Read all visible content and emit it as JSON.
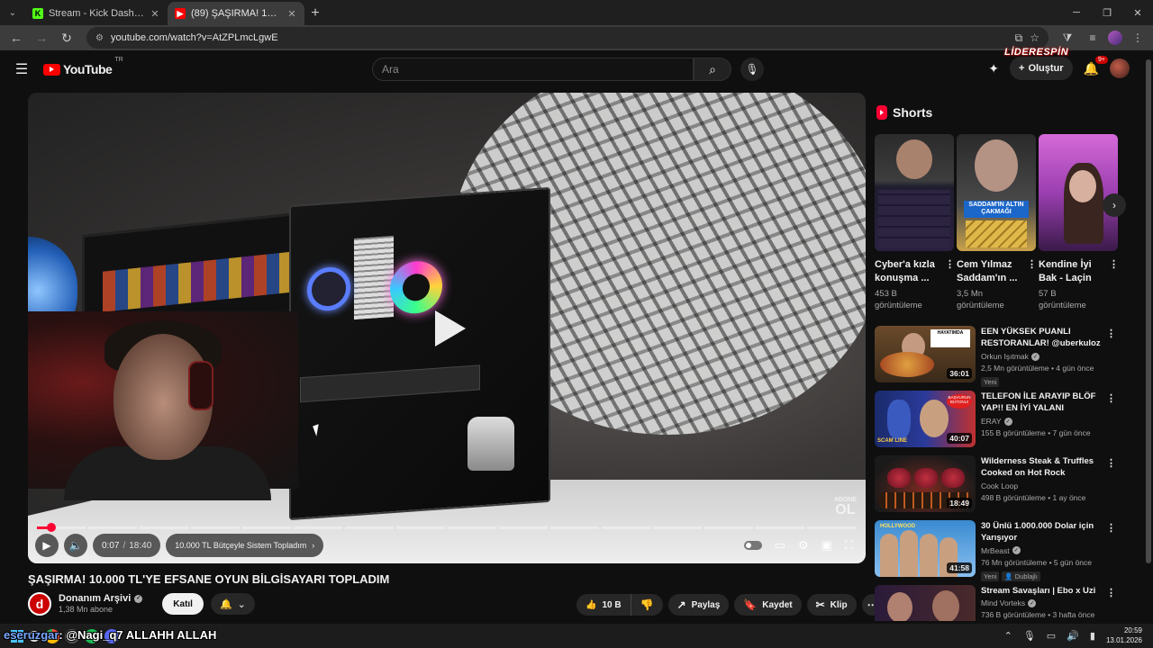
{
  "browser": {
    "tabs": [
      {
        "title": "Stream - Kick Dashboard",
        "favicon": "kick-icon",
        "active": false
      },
      {
        "title": "(89) ŞAŞIRMA! 10.000 TL'YE EFSANE",
        "favicon": "youtube-icon",
        "active": true
      }
    ],
    "url": "youtube.com/watch?v=AtZPLmcLgwE"
  },
  "header": {
    "logo_text": "YouTube",
    "logo_region": "TR",
    "search_placeholder": "Ara",
    "create_label": "Oluştur",
    "notification_count": "9+",
    "overlay_brand": "LİDERESPİN"
  },
  "player": {
    "time_current": "0:07",
    "time_separator": "/",
    "time_total": "18:40",
    "chapter": "10.000 TL Bütçeyle Sistem Topladım",
    "progress": 0.006,
    "watermark_top": "ABONE",
    "watermark_bottom": "OL"
  },
  "video": {
    "title": "ŞAŞIRMA! 10.000 TL'YE EFSANE OYUN BİLGİSAYARI TOPLADIM",
    "channel_name": "Donanım Arşivi",
    "subscribers": "1,38 Mn abone",
    "join_label": "Katıl",
    "like_count": "10 B",
    "share_label": "Paylaş",
    "save_label": "Kaydet",
    "clip_label": "Klip"
  },
  "shorts": {
    "heading": "Shorts",
    "items": [
      {
        "title": "Cyber'a kızla konuşma ...",
        "views_line1": "453 B",
        "views_line2": "görüntüleme"
      },
      {
        "title": "Cem Yılmaz Saddam'ın ...",
        "views_line1": "3,5 Mn",
        "views_line2": "görüntüleme",
        "thumb_caption": "SADDAM'IN ALTIN ÇAKMAĞI"
      },
      {
        "title": "Kendine İyi Bak - Laçin",
        "views_line1": "57 B",
        "views_line2": "görüntüleme"
      }
    ]
  },
  "recommendations": [
    {
      "title": "EEN YÜKSEK PUANLI RESTORANLAR! @uberkuloz ...",
      "channel": "Orkun Işıtmak",
      "verified": true,
      "meta": "2,5 Mn görüntüleme • 4 gün önce",
      "tags": [
        "Yeni"
      ],
      "duration": "36:01",
      "thumb_text": "HAYATIMDA"
    },
    {
      "title": "TELEFON İLE ARAYIP BLÖF YAP!! EN İYİ YALANI SÖYLEYE...",
      "channel": "ERAY",
      "verified": true,
      "meta": "155 B görüntüleme • 7 gün önce",
      "tags": [],
      "duration": "40:07",
      "thumb_text": "SCAM LINE",
      "thumb_bubble": "BAŞVURUN BUTONU!"
    },
    {
      "title": "Wilderness Steak & Truffles Cooked on Hot Rock",
      "channel": "Cook Loop",
      "verified": false,
      "meta": "498 B görüntüleme • 1 ay önce",
      "tags": [],
      "duration": "18:49"
    },
    {
      "title": "30 Ünlü 1.000.000 Dolar için Yarışıyor",
      "channel": "MrBeast",
      "verified": true,
      "meta": "76 Mn görüntüleme • 5 gün önce",
      "tags": [
        "Yeni",
        "Dublajlı"
      ],
      "duration": "41:58",
      "thumb_text": "HOLLYWOOD"
    },
    {
      "title": "Stream Savaşları | Ebo x Uzi",
      "channel": "Mind Vorteks",
      "verified": true,
      "meta": "736 B görüntüleme • 3 hafta önce",
      "tags": [],
      "duration": ""
    }
  ],
  "stream_overlay": {
    "chat_user": "eseruzgar",
    "chat_message": ": @Nagi_q7 ALLAHH ALLAH"
  },
  "taskbar": {
    "time": "20:59",
    "date": "13.01.2026"
  },
  "colors": {
    "accent": "#ff0033",
    "background": "#0f0f0f",
    "chip": "#272727"
  }
}
